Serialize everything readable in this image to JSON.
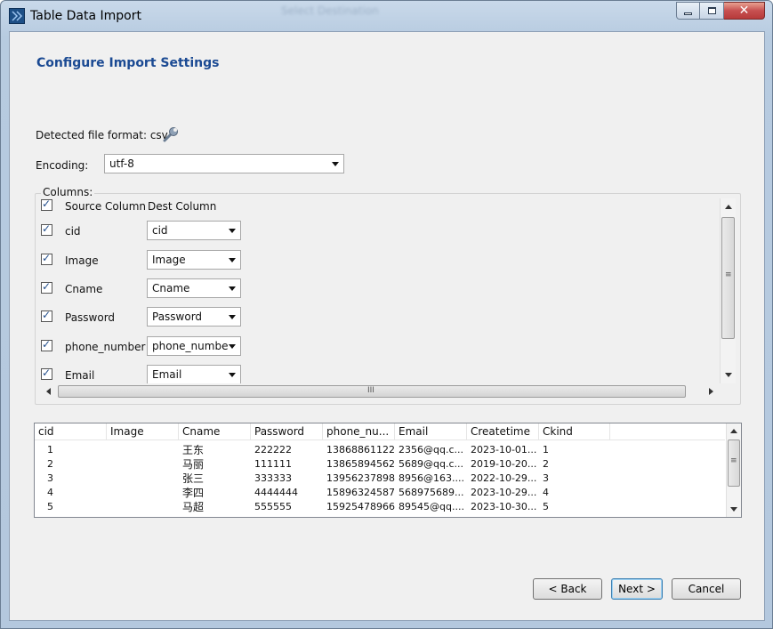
{
  "window": {
    "title": "Table Data Import",
    "background_title": "Select Destination"
  },
  "page": {
    "heading": "Configure Import Settings"
  },
  "format": {
    "label": "Detected file format: csv",
    "icon": "wrench-icon"
  },
  "encoding": {
    "label": "Encoding:",
    "value": "utf-8"
  },
  "columns": {
    "legend": "Columns:",
    "header_source": "Source Column",
    "header_dest": "Dest Column",
    "rows": [
      {
        "source": "cid",
        "dest": "cid"
      },
      {
        "source": "Image",
        "dest": "Image"
      },
      {
        "source": "Cname",
        "dest": "Cname"
      },
      {
        "source": "Password",
        "dest": "Password"
      },
      {
        "source": "phone_number",
        "dest": "phone_numbe"
      },
      {
        "source": "Email",
        "dest": "Email"
      }
    ],
    "hscroll_grip": "III",
    "vscroll_grip": "≡"
  },
  "preview": {
    "headers": [
      "cid",
      "Image",
      "Cname",
      "Password",
      "phone_nu...",
      "Email",
      "Createtime",
      "Ckind"
    ],
    "rows": [
      [
        "1",
        "",
        "王东",
        "222222",
        "13868861122",
        "2356@qq.c...",
        "2023-10-01...",
        "1"
      ],
      [
        "2",
        "",
        "马丽",
        "111111",
        "13865894562",
        "5689@qq.c...",
        "2019-10-20...",
        "2"
      ],
      [
        "3",
        "",
        "张三",
        "333333",
        "13956237898",
        "8956@163....",
        "2022-10-29...",
        "3"
      ],
      [
        "4",
        "",
        "李四",
        "4444444",
        "15896324587",
        "568975689...",
        "2023-10-29...",
        "4"
      ],
      [
        "5",
        "",
        "马超",
        "555555",
        "15925478966",
        "89545@qq....",
        "2023-10-30...",
        "5"
      ]
    ]
  },
  "buttons": {
    "back": "< Back",
    "next": "Next >",
    "cancel": "Cancel"
  },
  "colors": {
    "heading": "#1b4a93",
    "window_frame": "#b7cbe0",
    "close_button": "#c75050"
  }
}
